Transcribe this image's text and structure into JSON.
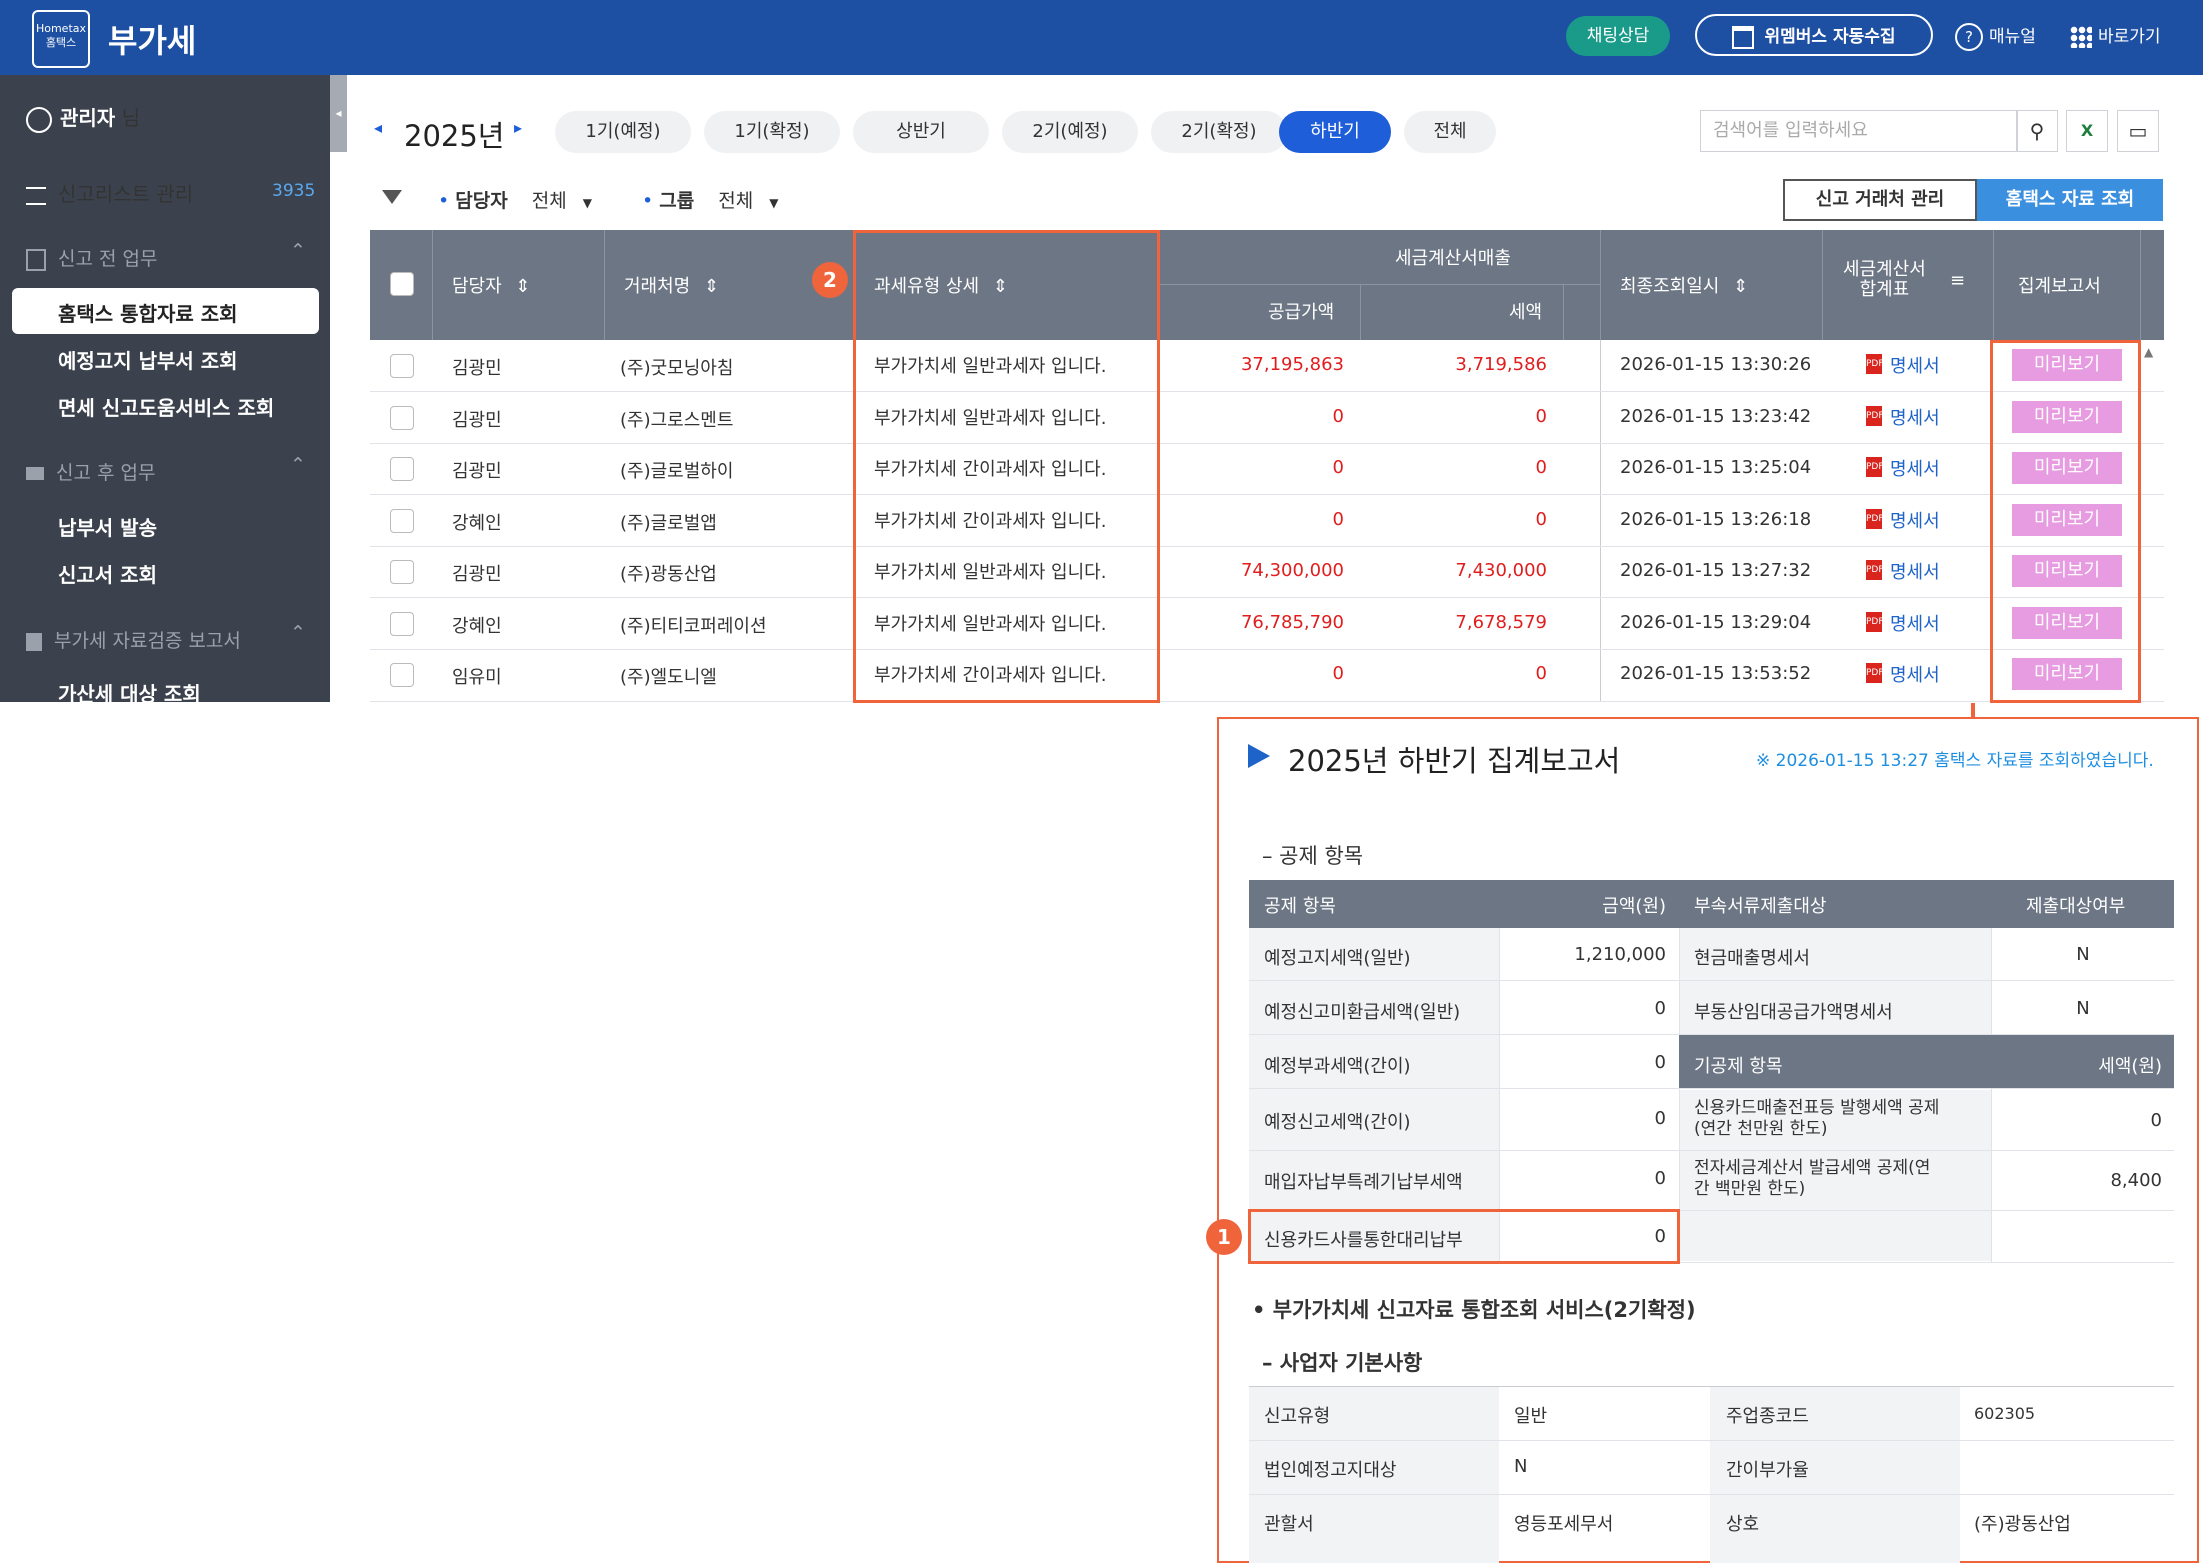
{
  "header": {
    "logo_text": "Hometax 홈택스",
    "app_title": "부가세",
    "chat_label": "채팅상담",
    "auto_collect_label": "위멤버스 자동수집",
    "manual_label": "매뉴얼",
    "shortcut_label": "바로가기"
  },
  "sidebar": {
    "user_name": "관리자",
    "user_suffix": "님",
    "report_list_label": "신고리스트 관리",
    "report_list_count": "3935",
    "section_pre": "신고 전 업무",
    "item_integrated": "홈택스 통합자료 조회",
    "item_prenotice": "예정고지 납부서 조회",
    "item_exempt": "면세 신고도움서비스 조회",
    "section_post": "신고 후 업무",
    "item_payment": "납부서 발송",
    "item_report": "신고서 조회",
    "section_verify": "부가세 자료검증 보고서",
    "item_penalty": "가산세 대상 조회"
  },
  "toolbar": {
    "year": "2025년",
    "tabs": [
      "1기(예정)",
      "1기(확정)",
      "상반기",
      "2기(예정)",
      "2기(확정)",
      "하반기",
      "전체"
    ],
    "active_tab": "하반기",
    "search_placeholder": "검색어를 입력하세요",
    "manager_label": "담당자",
    "manager_value": "전체",
    "group_label": "그룹",
    "group_value": "전체",
    "partner_btn": "신고 거래처 관리",
    "hometax_btn": "홈택스 자료 조회"
  },
  "grid": {
    "col_manager": "담당자",
    "col_company": "거래처명",
    "col_tax_type": "과세유형 상세",
    "col_sales_group": "세금계산서매출",
    "col_supply": "공급가액",
    "col_tax": "세액",
    "col_last_query": "최종조회일시",
    "col_invoice_summary_1": "세금계산서",
    "col_invoice_summary_2": "합계표",
    "col_report": "집계보고서",
    "detail_label": "명세서",
    "preview_label": "미리보기",
    "rows": [
      {
        "manager": "김광민",
        "company": "(주)굿모닝아침",
        "tax_type": "부가가치세 일반과세자 입니다.",
        "supply": "37,195,863",
        "tax": "3,719,586",
        "date": "2026-01-15 13:30:26"
      },
      {
        "manager": "김광민",
        "company": "(주)그로스멘트",
        "tax_type": "부가가치세 일반과세자 입니다.",
        "supply": "0",
        "tax": "0",
        "date": "2026-01-15 13:23:42"
      },
      {
        "manager": "김광민",
        "company": "(주)글로벌하이",
        "tax_type": "부가가치세 간이과세자 입니다.",
        "supply": "0",
        "tax": "0",
        "date": "2026-01-15 13:25:04"
      },
      {
        "manager": "강혜인",
        "company": "(주)글로벌앱",
        "tax_type": "부가가치세 간이과세자 입니다.",
        "supply": "0",
        "tax": "0",
        "date": "2026-01-15 13:26:18"
      },
      {
        "manager": "김광민",
        "company": "(주)광동산업",
        "tax_type": "부가가치세 일반과세자 입니다.",
        "supply": "74,300,000",
        "tax": "7,430,000",
        "date": "2026-01-15 13:27:32"
      },
      {
        "manager": "강혜인",
        "company": "(주)티티코퍼레이션",
        "tax_type": "부가가치세 일반과세자 입니다.",
        "supply": "76,785,790",
        "tax": "7,678,579",
        "date": "2026-01-15 13:29:04"
      },
      {
        "manager": "임유미",
        "company": "(주)엘도니엘",
        "tax_type": "부가가치세 간이과세자 입니다.",
        "supply": "0",
        "tax": "0",
        "date": "2026-01-15 13:53:52"
      }
    ]
  },
  "callouts": {
    "one": "1",
    "two": "2"
  },
  "report": {
    "title": "2025년 하반기 집계보고서",
    "notice": "※ 2026-01-15 13:27 홈택스 자료를 조회하였습니다.",
    "deduct_section": "– 공제 항목",
    "head_deduct": "공제 항목",
    "head_amount": "금액(원)",
    "head_docs": "부속서류제출대상",
    "head_submit": "제출대상여부",
    "deduct_rows": [
      {
        "label": "예정고지세액(일반)",
        "amount": "1,210,000"
      },
      {
        "label": "예정신고미환급세액(일반)",
        "amount": "0"
      },
      {
        "label": "예정부과세액(간이)",
        "amount": "0"
      },
      {
        "label": "예정신고세액(간이)",
        "amount": "0"
      },
      {
        "label": "매입자납부특례기납부세액",
        "amount": "0"
      },
      {
        "label": "신용카드사를통한대리납부",
        "amount": "0"
      }
    ],
    "doc_rows": [
      {
        "label": "현금매출명세서",
        "value": "N"
      },
      {
        "label": "부동산임대공급가액명세서",
        "value": "N"
      }
    ],
    "other_head": "기공제 항목",
    "other_head_amount": "세액(원)",
    "other_rows": [
      {
        "label1": "신용카드매출전표등 발행세액 공제",
        "label2": "(연간 천만원 한도)",
        "value": "0"
      },
      {
        "label1": "전자세금계산서 발급세액 공제(연",
        "label2": "간 백만원 한도)",
        "value": "8,400"
      }
    ],
    "service_title": "• 부가가치세 신고자료 통합조회 서비스(2기확정)",
    "basic_section": "– 사업자 기본사항",
    "basic_rows": [
      {
        "k1": "신고유형",
        "v1": "일반",
        "k2": "주업종코드",
        "v2": "602305"
      },
      {
        "k1": "법인예정고지대상",
        "v1": "N",
        "k2": "간이부가율",
        "v2": ""
      },
      {
        "k1": "관할서",
        "v1": "영등포세무서",
        "k2": "상호",
        "v2": "(주)광동산업"
      }
    ]
  }
}
